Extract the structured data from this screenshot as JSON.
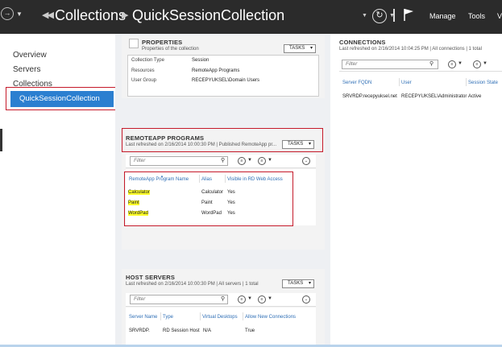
{
  "header": {
    "nav_back_icon": "back-arrow-icon",
    "breadcrumb": [
      "Collections",
      "QuickSessionCollection"
    ],
    "menu": [
      "Manage",
      "Tools",
      "V"
    ]
  },
  "sidebar": {
    "items": [
      {
        "label": "Overview"
      },
      {
        "label": "Servers"
      },
      {
        "label": "Collections"
      },
      {
        "label": "QuickSessionCollection",
        "selected": true
      }
    ]
  },
  "properties": {
    "title": "PROPERTIES",
    "subtitle": "Properties of the collection",
    "tasks": "TASKS",
    "rows": [
      {
        "key": "Collection Type",
        "value": "Session"
      },
      {
        "key": "Resources",
        "value": "RemoteApp Programs"
      },
      {
        "key": "User Group",
        "value": "RECEPYUKSEL\\Domain Users"
      }
    ]
  },
  "remoteapp": {
    "title": "REMOTEAPP PROGRAMS",
    "subtitle": "Last refreshed on 2/16/2014 10:00:30 PM | Published RemoteApp pr...",
    "tasks": "TASKS",
    "filter_placeholder": "Filter",
    "columns": [
      "RemoteApp Program Name",
      "Alias",
      "Visible in RD Web Access"
    ],
    "rows": [
      [
        "Calculator",
        "Calculator",
        "Yes"
      ],
      [
        "Paint",
        "Paint",
        "Yes"
      ],
      [
        "WordPad",
        "WordPad",
        "Yes"
      ]
    ]
  },
  "hostservers": {
    "title": "HOST SERVERS",
    "subtitle": "Last refreshed on 2/16/2014 10:00:30 PM | All servers | 1 total",
    "tasks": "TASKS",
    "filter_placeholder": "Filter",
    "columns": [
      "Server Name",
      "Type",
      "Virtual Desktops",
      "Allow New Connections"
    ],
    "rows": [
      [
        "SRVRDP.",
        "RD Session Host",
        "N/A",
        "True"
      ]
    ]
  },
  "connections": {
    "title": "CONNECTIONS",
    "subtitle": "Last refreshed on 2/16/2014 10:04:25 PM | All connections | 1 total",
    "filter_placeholder": "Filter",
    "columns": [
      "Server FQDN",
      "User",
      "Session State"
    ],
    "rows": [
      [
        "SRVRDP.recepyuksel.net",
        "RECEPYUKSEL\\Administrator",
        "Active"
      ]
    ]
  },
  "colors": {
    "topbar": "#2b2b2b",
    "selection": "#2b7fd0",
    "highlight": "#ffff2a",
    "annotation_red": "#c51a2a",
    "link_blue": "#2f6fb6"
  }
}
